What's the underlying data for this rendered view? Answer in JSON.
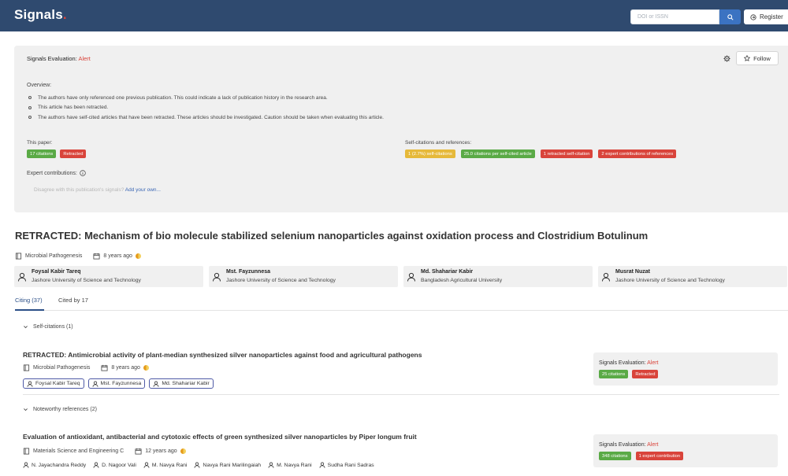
{
  "header": {
    "logo": "Signals",
    "logo_dot": ".",
    "search_placeholder": "DOI or ISSN",
    "register_label": "Register"
  },
  "evaluation": {
    "title_prefix": "Signals Evaluation:",
    "status": "Alert",
    "follow_label": "Follow",
    "overview_label": "Overview:",
    "overview_items": [
      "The authors have only referenced one previous publication. This could indicate a lack of publication history in the research area.",
      "This article has been retracted.",
      "The authors have self-cited articles that have been retracted. These articles should be investigated. Caution should be taken when evaluating this article."
    ],
    "this_paper_label": "This paper:",
    "this_paper_badges": [
      "17 citations",
      "Retracted"
    ],
    "self_citations_label": "Self-citations and references:",
    "self_citation_badges": [
      "1 (2.7%) self-citations",
      "25.0 citations per self-cited article",
      "1 retracted self-citation",
      "2 expert contributions of references"
    ],
    "expert_label": "Expert contributions:",
    "disagree_text": "Disagree with this publication's signals?",
    "add_own_link": "Add your own..."
  },
  "article": {
    "title": "RETRACTED: Mechanism of bio molecule stabilized selenium nanoparticles against oxidation process and Clostridium Botulinum",
    "journal": "Microbial Pathogenesis",
    "age": "8 years ago",
    "authors": [
      {
        "name": "Foysal Kabir Tareq",
        "affiliation": "Jashore University of Science and Technology"
      },
      {
        "name": "Mst. Fayzunnesa",
        "affiliation": "Jashore University of Science and Technology"
      },
      {
        "name": "Md. Shahariar Kabir",
        "affiliation": "Bangladesh Agricultural University"
      },
      {
        "name": "Musrat Nuzat",
        "affiliation": "Jashore University of Science and Technology"
      }
    ]
  },
  "tabs": {
    "citing": "Citing (37)",
    "cited_by": "Cited by 17"
  },
  "groups": [
    {
      "heading": "Self-citations (1)",
      "item": {
        "title": "RETRACTED: Antimicrobial activity of plant-median synthesized silver nanoparticles against food and agricultural pathogens",
        "journal": "Microbial Pathogenesis",
        "age": "8 years ago",
        "authors": [
          "Foysal Kabir Tareq",
          "Mst. Fayzunnesa",
          "Md. Shahariar Kabir"
        ],
        "signals_prefix": "Signals Evaluation:",
        "signals_status": "Alert",
        "badges": [
          "25 citations",
          "Retracted"
        ]
      }
    },
    {
      "heading": "Noteworthy references (2)",
      "item": {
        "title": "Evaluation of antioxidant, antibacterial and cytotoxic effects of green synthesized silver nanoparticles by Piper longum fruit",
        "journal": "Materials Science and Engineering C",
        "age": "12 years ago",
        "authors": [
          "N. Jayachandra Reddy",
          "D. Nagoor Vali",
          "M. Navya Rani",
          "Navya Rani Marilingaiah",
          "M. Navya Rani",
          "Sudha Rani Sadras"
        ],
        "signals_prefix": "Signals Evaluation:",
        "signals_status": "Alert",
        "badges": [
          "348 citations",
          "1 expert contribution"
        ]
      }
    }
  ],
  "colors": {
    "header_bg": "#2f4a6f",
    "alert": "#d9443b",
    "green": "#5aaa46",
    "yellow": "#e6b93a",
    "link": "#3a66b4"
  }
}
